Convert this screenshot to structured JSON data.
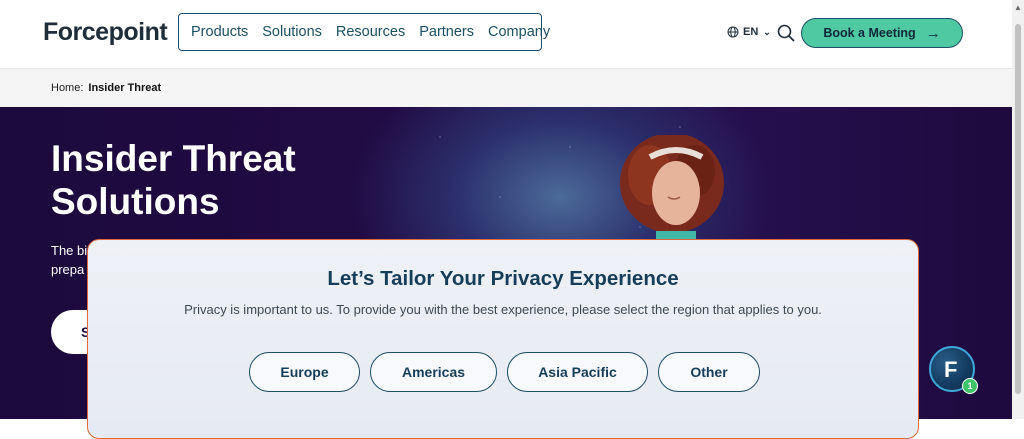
{
  "header": {
    "logo_text": "Forcepoint",
    "nav": [
      "Products",
      "Solutions",
      "Resources",
      "Partners",
      "Company"
    ],
    "language": "EN",
    "cta_label": "Book a Meeting",
    "cta_color": "#4fc9a1"
  },
  "breadcrumb": {
    "home": "Home:",
    "current": "Insider Threat"
  },
  "hero": {
    "title": "Insider Threat Solutions",
    "subtitle_line1": "The bi",
    "subtitle_line2": "prepa",
    "button_label": "S"
  },
  "modal": {
    "title": "Let’s Tailor Your Privacy Experience",
    "text": "Privacy is important to us. To provide you with the best experience, please select the region that applies to you.",
    "regions": [
      "Europe",
      "Americas",
      "Asia Pacific",
      "Other"
    ],
    "border_color": "#e1683a"
  },
  "chat": {
    "icon_letter": "F",
    "badge_count": "1"
  }
}
